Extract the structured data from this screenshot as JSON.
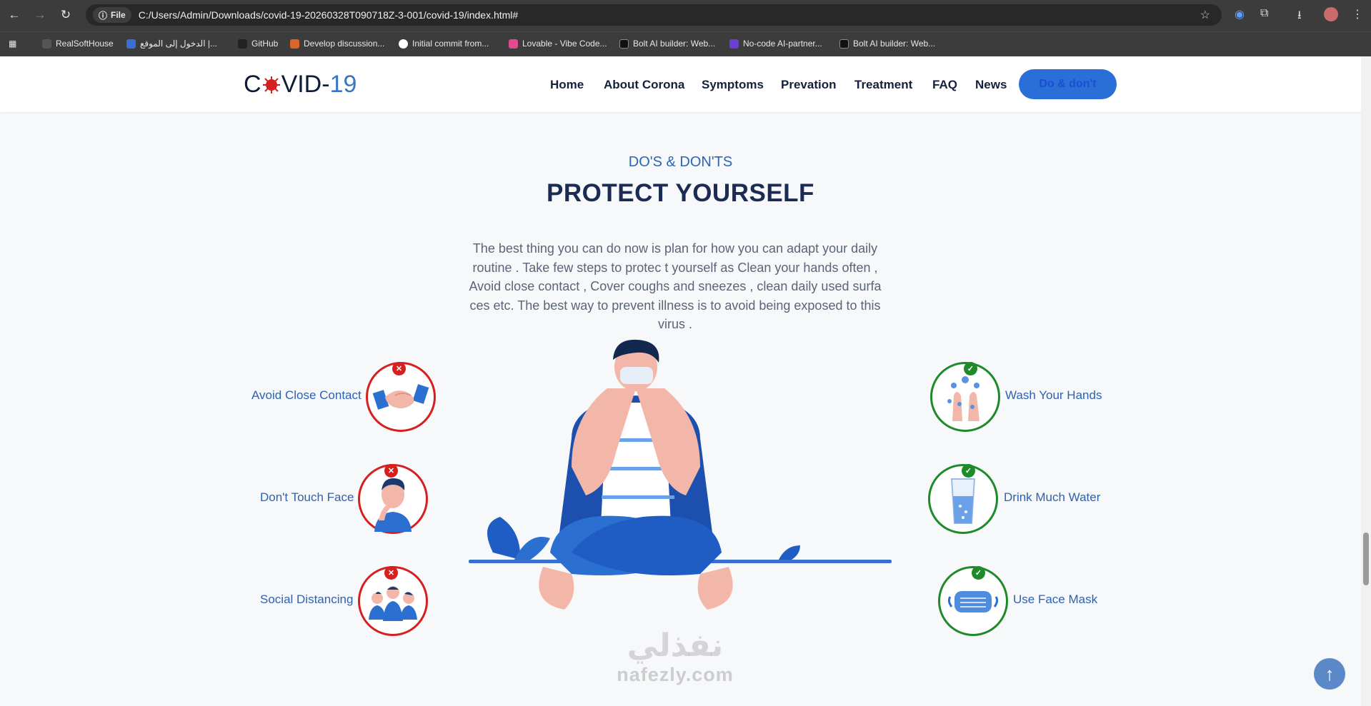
{
  "browser": {
    "file_chip": "File",
    "url": "C:/Users/Admin/Downloads/covid-19-20260328T090718Z-3-001/covid-19/index.html#",
    "bookmarks": [
      {
        "label": "RealSoftHouse",
        "color": "#555"
      },
      {
        "label": "الدخول إلى الموقع |...",
        "color": "#3a6fd8"
      },
      {
        "label": "GitHub",
        "color": "#222"
      },
      {
        "label": "Develop discussion...",
        "color": "#d9652b"
      },
      {
        "label": "Initial commit from...",
        "color": "#ffffff"
      },
      {
        "label": "Lovable - Vibe Code...",
        "color": "#e24a8d"
      },
      {
        "label": "Bolt AI builder: Web...",
        "color": "#111"
      },
      {
        "label": "No-code AI-partner...",
        "color": "#6b3fd6"
      },
      {
        "label": "Bolt AI builder: Web...",
        "color": "#111"
      }
    ]
  },
  "site": {
    "logo_prefix": "C",
    "logo_mid": "VID-",
    "logo_num": "19",
    "nav": [
      "Home",
      "About Corona",
      "Symptoms",
      "Prevation",
      "Treatment",
      "FAQ",
      "News"
    ],
    "cta": "Do & don't"
  },
  "section": {
    "kicker": "DO'S & DON'TS",
    "title": "PROTECT YOURSELF",
    "intro": "The best thing you can do now is plan for how you can adapt your daily routine . Take few steps to protec t yourself as Clean your hands often , Avoid close contact , Cover coughs and sneezes , clean daily used surfa ces etc. The best way to prevent illness is to avoid being exposed to this virus ."
  },
  "donts": [
    {
      "label": "Avoid Close Contact",
      "icon": "handshake-icon"
    },
    {
      "label": "Don't Touch Face",
      "icon": "touch-face-icon"
    },
    {
      "label": "Social Distancing",
      "icon": "crowd-icon"
    }
  ],
  "dos": [
    {
      "label": "Wash Your Hands",
      "icon": "wash-hands-icon"
    },
    {
      "label": "Drink Much Water",
      "icon": "water-glass-icon"
    },
    {
      "label": "Use Face Mask",
      "icon": "face-mask-icon"
    }
  ],
  "watermark": {
    "arabic": "نفذلي",
    "latin": "nafezly.com"
  },
  "colors": {
    "accent": "#2a6fd8",
    "dont": "#d61f1f",
    "do": "#1e8a2a",
    "title": "#1b2b54"
  }
}
